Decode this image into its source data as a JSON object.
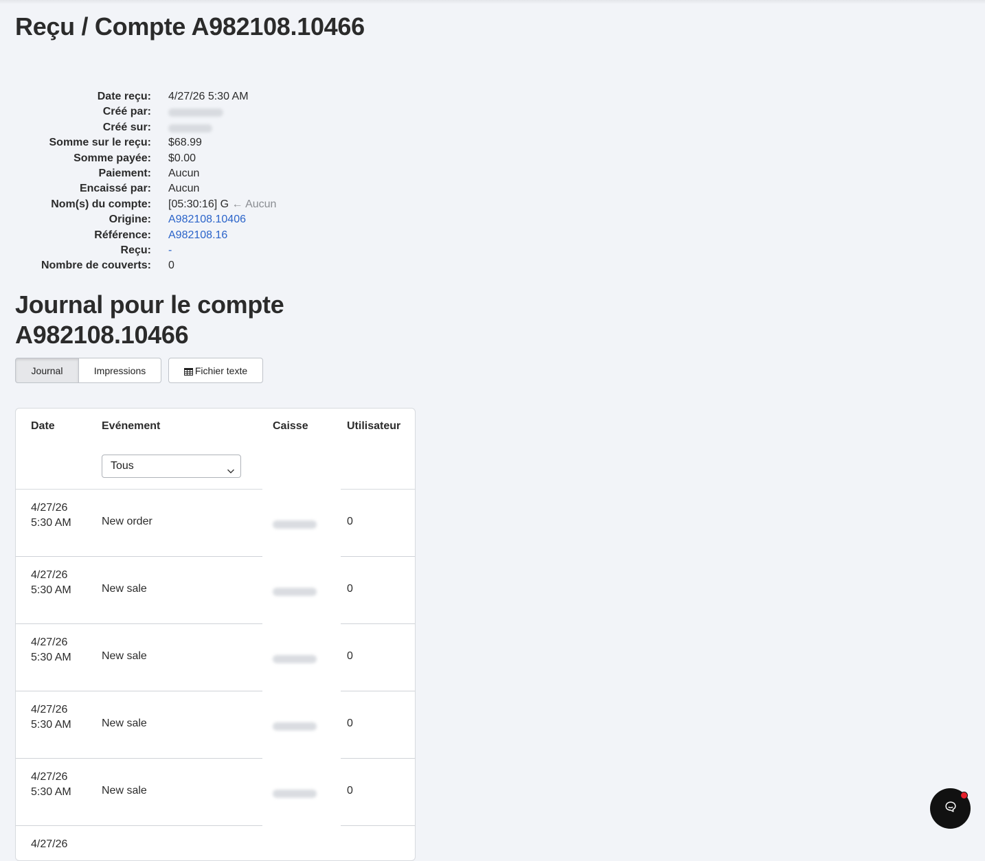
{
  "header": {
    "title": "Reçu / Compte A982108.10466"
  },
  "details": [
    {
      "label": "Date reçu:",
      "value": "4/27/26 5:30 AM",
      "type": "text"
    },
    {
      "label": "Créé par:",
      "value": "",
      "type": "blurred"
    },
    {
      "label": "Créé sur:",
      "value": "",
      "type": "blurred"
    },
    {
      "label": "Somme sur le reçu:",
      "value": "$68.99",
      "type": "text"
    },
    {
      "label": "Somme payée:",
      "value": "$0.00",
      "type": "text"
    },
    {
      "label": "Paiement:",
      "value": "Aucun",
      "type": "text"
    },
    {
      "label": "Encaissé par:",
      "value": "Aucun",
      "type": "text"
    },
    {
      "label": "Nom(s) du compte:",
      "value": "[05:30:16] G",
      "arrow": "←",
      "extra": "Aucun",
      "type": "name"
    },
    {
      "label": "Origine:",
      "value": "A982108.10406",
      "type": "link"
    },
    {
      "label": "Référence:",
      "value": "A982108.16",
      "type": "link"
    },
    {
      "label": "Reçu:",
      "value": "-",
      "type": "link"
    },
    {
      "label": "Nombre de couverts:",
      "value": "0",
      "type": "text"
    }
  ],
  "journal": {
    "title": "Journal pour le compte A982108.10466",
    "tabs": {
      "journal": "Journal",
      "impressions": "Impressions"
    },
    "export_label": "Fichier texte",
    "filter": {
      "selected": "Tous"
    },
    "columns": {
      "date": "Date",
      "event": "Evénement",
      "register": "Caisse",
      "user": "Utilisateur"
    },
    "rows": [
      {
        "date": "4/27/26 5:30 AM",
        "event": "New order",
        "user": "0"
      },
      {
        "date": "4/27/26 5:30 AM",
        "event": "New sale",
        "user": "0"
      },
      {
        "date": "4/27/26 5:30 AM",
        "event": "New sale",
        "user": "0"
      },
      {
        "date": "4/27/26 5:30 AM",
        "event": "New sale",
        "user": "0"
      },
      {
        "date": "4/27/26 5:30 AM",
        "event": "New sale",
        "user": "0"
      },
      {
        "date": "4/27/26",
        "event": "",
        "user": ""
      }
    ]
  },
  "colors": {
    "link": "#2a63c9",
    "background": "#f2f4f8",
    "notification": "#e5202c"
  },
  "icons": {
    "export": "table-icon",
    "chat": "chat-bubble-icon",
    "select": "chevron-down-icon"
  }
}
